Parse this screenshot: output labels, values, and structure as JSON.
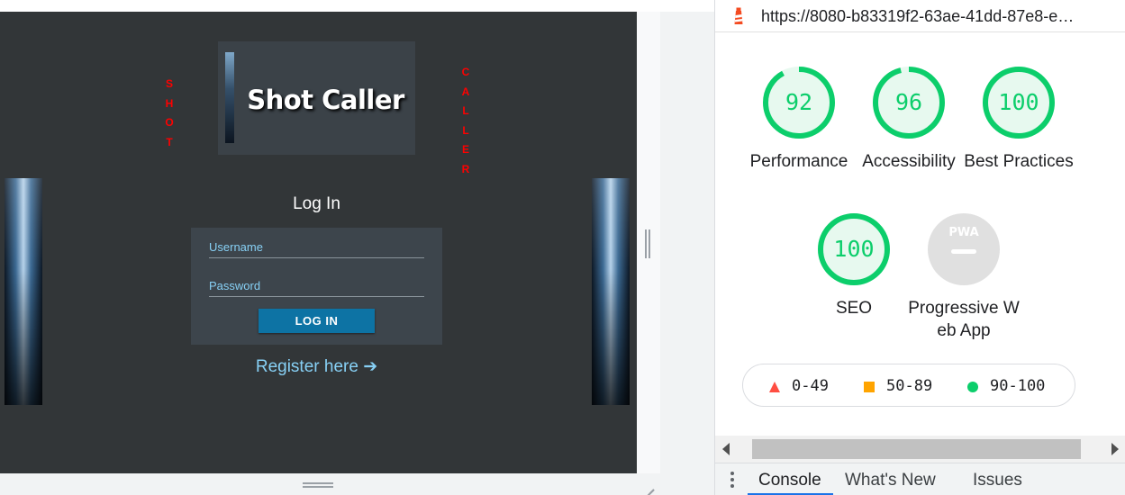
{
  "app": {
    "side_word_left": [
      "S",
      "H",
      "O",
      "T"
    ],
    "side_word_right": [
      "C",
      "A",
      "L",
      "L",
      "E",
      "R"
    ],
    "logo_title": "Shot Caller",
    "login_heading": "Log In",
    "username_placeholder": "Username",
    "password_placeholder": "Password",
    "login_button": "LOG IN",
    "register_text": "Register here",
    "register_arrow": "➔"
  },
  "devtools": {
    "url": "https://8080-b83319f2-63ae-41dd-87e8-e…",
    "lighthouse_icon": "lighthouse-icon",
    "scores": [
      {
        "value": 92,
        "label": "Performance",
        "color": "#0cce6b"
      },
      {
        "value": 96,
        "label": "Accessibility",
        "color": "#0cce6b"
      },
      {
        "value": 100,
        "label": "Best Practices",
        "color": "#0cce6b"
      },
      {
        "value": 100,
        "label": "SEO",
        "color": "#0cce6b"
      }
    ],
    "pwa": {
      "badge": "PWA",
      "label": "Progressive Web App",
      "color": "#e0e0e0"
    },
    "legend": [
      {
        "range": "0-49",
        "color": "#ff4e42",
        "shape": "triangle"
      },
      {
        "range": "50-89",
        "color": "#ffa400",
        "shape": "square"
      },
      {
        "range": "90-100",
        "color": "#0cce6b",
        "shape": "circle"
      }
    ],
    "tabs": [
      "Console",
      "What's New",
      "Issues"
    ],
    "active_tab": "Console"
  }
}
